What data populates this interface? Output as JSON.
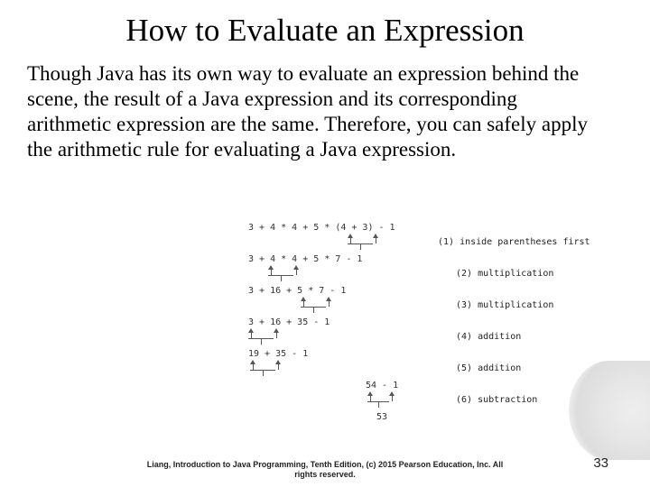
{
  "title": "How to Evaluate an Expression",
  "body": "Though Java has its own way to evaluate an expression behind the scene, the result of a Java expression and its corresponding arithmetic expression are the same. Therefore, you can safely apply the arithmetic rule for evaluating a Java expression.",
  "steps": [
    {
      "expr": "3 + 4 * 4 + 5 * (4 + 3) - 1",
      "annot": "(1) inside parentheses first"
    },
    {
      "expr": "3 + 4 * 4 + 5 * 7 - 1",
      "annot": "(2) multiplication"
    },
    {
      "expr": "3 + 16 + 5 * 7 - 1",
      "annot": "(3) multiplication"
    },
    {
      "expr": "3 + 16 + 35 - 1",
      "annot": "(4) addition"
    },
    {
      "expr": "19 + 35 - 1",
      "annot": "(5) addition"
    },
    {
      "expr": "54 - 1",
      "annot": "(6) subtraction"
    }
  ],
  "result": "53",
  "footer_line1": "Liang, Introduction to Java Programming, Tenth Edition, (c) 2015 Pearson Education, Inc. All",
  "footer_line2": "rights reserved.",
  "page_number": "33"
}
